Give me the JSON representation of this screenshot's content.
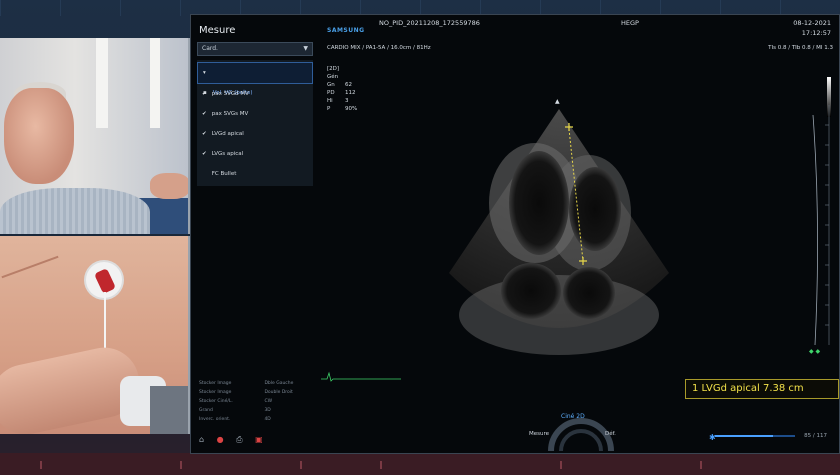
{
  "header": {
    "brand": "SAMSUNG",
    "patient_id": "NO_PID_20211208_172559786",
    "institution": "HEGP",
    "date": "08-12-2021",
    "time": "17:12:57",
    "probe_line": "CARDIO MIX / PA1-5A / 16.0cm / 81Hz",
    "ti_line": "TIs 0.8 / TIb 0.8 / MI 1.3"
  },
  "menu": {
    "title": "Mesure",
    "selected": "Card.",
    "items": [
      {
        "label": "Vol. VG (boîte)",
        "prefix": "▾ ▪",
        "active": true
      },
      {
        "label": "pax SVGd MV",
        "prefix": "✔",
        "active": false
      },
      {
        "label": "pax SVGs MV",
        "prefix": "✔",
        "active": false
      },
      {
        "label": "LVGd apical",
        "prefix": "✔",
        "active": false
      },
      {
        "label": "LVGs apical",
        "prefix": "✔",
        "active": false
      },
      {
        "label": "FC Bullet",
        "prefix": "",
        "active": false
      }
    ]
  },
  "params": [
    {
      "k": "[2D]",
      "v": ""
    },
    {
      "k": "Gén",
      "v": ""
    },
    {
      "k": "Gn",
      "v": "62"
    },
    {
      "k": "PD",
      "v": "112"
    },
    {
      "k": "Hi",
      "v": "3"
    },
    {
      "k": "P",
      "v": "90%"
    }
  ],
  "measurement": {
    "text": "1  LVGd apical   7.38 cm"
  },
  "shortcuts": {
    "col1": [
      "Stocker Image",
      "Stocker Image",
      "Stocker Ciné/L.",
      "Grand",
      "Inverc. orient."
    ],
    "col2": [
      "Dble Gauche",
      "Double Droit",
      "CW",
      "3D",
      "4D"
    ]
  },
  "dial": {
    "center_label": "Ciné 2D",
    "left_label": "Mesure",
    "right_label": "Déf."
  },
  "status": {
    "frame_count": "85 / 117",
    "cine_progress": 0.72
  },
  "colors": {
    "accent": "#4aa0e8",
    "measure": "#f2e14a",
    "menu_active": "#7fb3ff"
  }
}
